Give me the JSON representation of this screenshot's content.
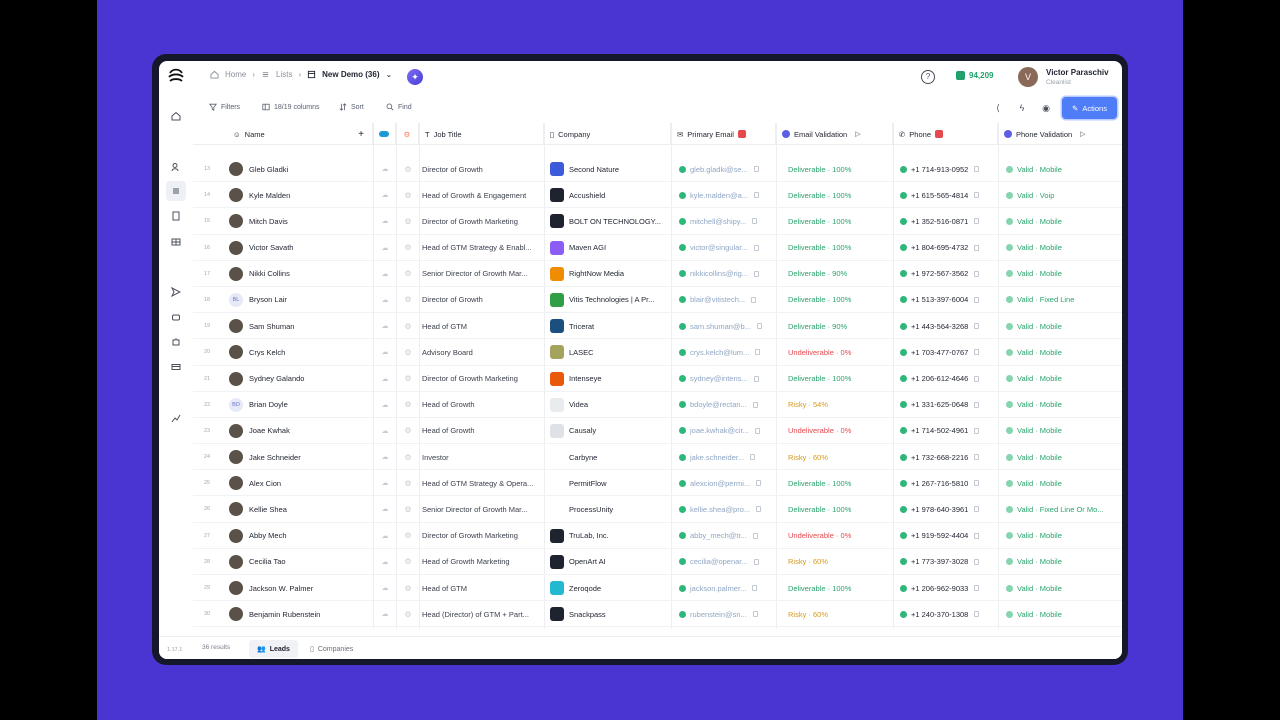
{
  "breadcrumb": {
    "home": "Home",
    "lists": "Lists",
    "current": "New Demo (36)"
  },
  "credits": "94,209",
  "user": {
    "initial": "V",
    "name": "Victor Paraschiv",
    "org": "Cleanlist"
  },
  "toolbar": {
    "filters": "Filters",
    "columns": "18/19 columns",
    "sort": "Sort",
    "find": "Find",
    "actions": "Actions"
  },
  "columns": {
    "name": "Name",
    "job": "Job Title",
    "company": "Company",
    "email": "Primary Email",
    "email_validation": "Email Validation",
    "phone": "Phone",
    "phone_validation": "Phone Validation"
  },
  "rows": [
    {
      "num": "13",
      "name": "Gleb Gladki",
      "initials": "",
      "job": "Director of Growth",
      "company": "Second Nature",
      "logo_color": "#3b5bdb",
      "email": "gleb.gladki@se...",
      "ev": "Deliverable · 100%",
      "ev_status": "deliverable",
      "phone": "+1 714-913-0952",
      "pv": "Valid · Mobile"
    },
    {
      "num": "14",
      "name": "Kyle Malden",
      "initials": "",
      "job": "Head of Growth & Engagement",
      "company": "Accushield",
      "logo_color": "#1f2330",
      "email": "kyle.malden@a...",
      "ev": "Deliverable · 100%",
      "ev_status": "deliverable",
      "phone": "+1 615-565-4814",
      "pv": "Valid · Voip"
    },
    {
      "num": "15",
      "name": "Mitch Davis",
      "initials": "",
      "job": "Director of Growth Marketing",
      "company": "BOLT ON TECHNOLOGY...",
      "logo_color": "#1f2330",
      "email": "mitchell@shipy...",
      "ev": "Deliverable · 100%",
      "ev_status": "deliverable",
      "phone": "+1 352-516-0871",
      "pv": "Valid · Mobile"
    },
    {
      "num": "16",
      "name": "Victor Savath",
      "initials": "",
      "job": "Head of GTM Strategy & Enabl...",
      "company": "Maven AGI",
      "logo_color": "#8b5cf6",
      "email": "victor@singular...",
      "ev": "Deliverable · 100%",
      "ev_status": "deliverable",
      "phone": "+1 804-695-4732",
      "pv": "Valid · Mobile"
    },
    {
      "num": "17",
      "name": "Nikki Collins",
      "initials": "",
      "job": "Senior Director of Growth Mar...",
      "company": "RightNow Media",
      "logo_color": "#f08c00",
      "email": "nikkicollins@rig...",
      "ev": "Deliverable · 90%",
      "ev_status": "deliverable",
      "phone": "+1 972-567-3562",
      "pv": "Valid · Mobile"
    },
    {
      "num": "18",
      "name": "Bryson Lair",
      "initials": "BL",
      "job": "Director of Growth",
      "company": "Vitis Technologies | A Pr...",
      "logo_color": "#2f9e44",
      "email": "blair@vitistech...",
      "ev": "Deliverable · 100%",
      "ev_status": "deliverable",
      "phone": "+1 513-397-6004",
      "pv": "Valid · Fixed Line"
    },
    {
      "num": "19",
      "name": "Sam Shuman",
      "initials": "",
      "job": "Head of GTM",
      "company": "Tricerat",
      "logo_color": "#1c4e80",
      "email": "sam.shuman@b...",
      "ev": "Deliverable · 90%",
      "ev_status": "deliverable",
      "phone": "+1 443-564-3268",
      "pv": "Valid · Mobile"
    },
    {
      "num": "20",
      "name": "Crys Kelch",
      "initials": "",
      "job": "Advisory Board",
      "company": "LASEC",
      "logo_color": "#a3a35b",
      "email": "crys.kelch@lum...",
      "ev": "Undeliverable · 0%",
      "ev_status": "undeliverable",
      "phone": "+1 703-477-0767",
      "pv": "Valid · Mobile"
    },
    {
      "num": "21",
      "name": "Sydney Galando",
      "initials": "",
      "job": "Director of Growth Marketing",
      "company": "Intenseye",
      "logo_color": "#e8590c",
      "email": "sydney@intens...",
      "ev": "Deliverable · 100%",
      "ev_status": "deliverable",
      "phone": "+1 206-612-4646",
      "pv": "Valid · Mobile"
    },
    {
      "num": "22",
      "name": "Brian Doyle",
      "initials": "BD",
      "job": "Head of Growth",
      "company": "Videa",
      "logo_color": "#e9ecef",
      "email": "bdoyle@rectan...",
      "ev": "Risky · 54%",
      "ev_status": "risky",
      "phone": "+1 331-625-0648",
      "pv": "Valid · Mobile"
    },
    {
      "num": "23",
      "name": "Joae Kwhak",
      "initials": "",
      "job": "Head of Growth",
      "company": "Causaly",
      "logo_color": "#dee2e6",
      "email": "joae.kwhak@cir...",
      "ev": "Undeliverable · 0%",
      "ev_status": "undeliverable",
      "phone": "+1 714-502-4961",
      "pv": "Valid · Mobile"
    },
    {
      "num": "24",
      "name": "Jake Schneider",
      "initials": "",
      "job": "Investor",
      "company": "Carbyne",
      "logo_color": "#ffffff",
      "email": "jake.schneider...",
      "ev": "Risky · 60%",
      "ev_status": "risky",
      "phone": "+1 732-668-2216",
      "pv": "Valid · Mobile"
    },
    {
      "num": "25",
      "name": "Alex Cion",
      "initials": "",
      "job": "Head of GTM Strategy & Opera...",
      "company": "PermitFlow",
      "logo_color": "#ffffff",
      "email": "alexcion@permi...",
      "ev": "Deliverable · 100%",
      "ev_status": "deliverable",
      "phone": "+1 267-716-5810",
      "pv": "Valid · Mobile"
    },
    {
      "num": "26",
      "name": "Kellie Shea",
      "initials": "",
      "job": "Senior Director of Growth Mar...",
      "company": "ProcessUnity",
      "logo_color": "#ffffff",
      "email": "kellie.shea@pro...",
      "ev": "Deliverable · 100%",
      "ev_status": "deliverable",
      "phone": "+1 978-640-3961",
      "pv": "Valid · Fixed Line Or Mo..."
    },
    {
      "num": "27",
      "name": "Abby Mech",
      "initials": "",
      "job": "Director of Growth Marketing",
      "company": "TruLab, Inc.",
      "logo_color": "#1f2330",
      "email": "abby_mech@tr...",
      "ev": "Undeliverable · 0%",
      "ev_status": "undeliverable",
      "phone": "+1 919-592-4404",
      "pv": "Valid · Mobile"
    },
    {
      "num": "28",
      "name": "Cecilia Tao",
      "initials": "",
      "job": "Head of Growth Marketing",
      "company": "OpenArt AI",
      "logo_color": "#1f2330",
      "email": "cecilia@openar...",
      "ev": "Risky · 60%",
      "ev_status": "risky",
      "phone": "+1 773-397-3028",
      "pv": "Valid · Mobile"
    },
    {
      "num": "29",
      "name": "Jackson W. Palmer",
      "initials": "",
      "job": "Head of GTM",
      "company": "Zeroqode",
      "logo_color": "#22b8cf",
      "email": "jackson.palmer...",
      "ev": "Deliverable · 100%",
      "ev_status": "deliverable",
      "phone": "+1 206-962-9033",
      "pv": "Valid · Mobile"
    },
    {
      "num": "30",
      "name": "Benjamin Rubenstein",
      "initials": "",
      "job": "Head (Director) of GTM + Part...",
      "company": "Snackpass",
      "logo_color": "#1f2330",
      "email": "rubenstein@sn...",
      "ev": "Risky · 60%",
      "ev_status": "risky",
      "phone": "+1 240-370-1308",
      "pv": "Valid · Mobile"
    }
  ],
  "footer": {
    "version": "1.17.1",
    "results": "36 results",
    "tab_leads": "Leads",
    "tab_companies": "Companies"
  }
}
